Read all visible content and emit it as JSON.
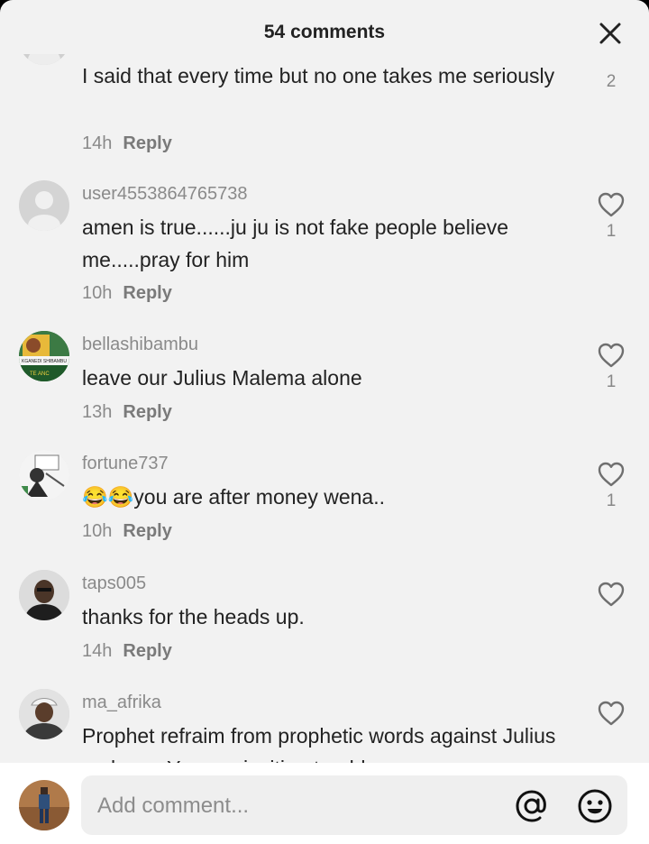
{
  "header": {
    "title": "54 comments"
  },
  "comments": [
    {
      "username": "",
      "text": "I said that every time but no one takes me seriously",
      "time": "14h",
      "reply": "Reply",
      "likes": "2"
    },
    {
      "username": "user4553864765738",
      "text": "amen is true......ju ju is not fake people believe me.....pray for him",
      "time": "10h",
      "reply": "Reply",
      "likes": "1"
    },
    {
      "username": "bellashibambu",
      "text": "leave our Julius Malema alone",
      "time": "13h",
      "reply": "Reply",
      "likes": "1"
    },
    {
      "username": "fortune737",
      "text": "😂😂you are after money wena..",
      "time": "10h",
      "reply": "Reply",
      "likes": "1"
    },
    {
      "username": "taps005",
      "text": "thanks for the heads up.",
      "time": "14h",
      "reply": "Reply",
      "likes": ""
    },
    {
      "username": "ma_afrika",
      "text": "Prophet refraim from prophetic words against Julius malema. You are inviting trouble",
      "time": "",
      "reply": "",
      "likes": ""
    }
  ],
  "avatar_text": {
    "bellashibambu": "KGANEDI SHIBAMBU",
    "bellashibambu_tag": "TE ANC"
  },
  "input": {
    "placeholder": "Add comment..."
  },
  "colors": {
    "sheet_bg": "#f2f2f2",
    "text": "#222222",
    "muted": "#8a8a8a",
    "heart_stroke": "#6f6f6f"
  },
  "icons": {
    "close": "close-icon",
    "like": "heart-outline-icon",
    "mention": "at-sign-icon",
    "emoji": "emoji-icon"
  }
}
